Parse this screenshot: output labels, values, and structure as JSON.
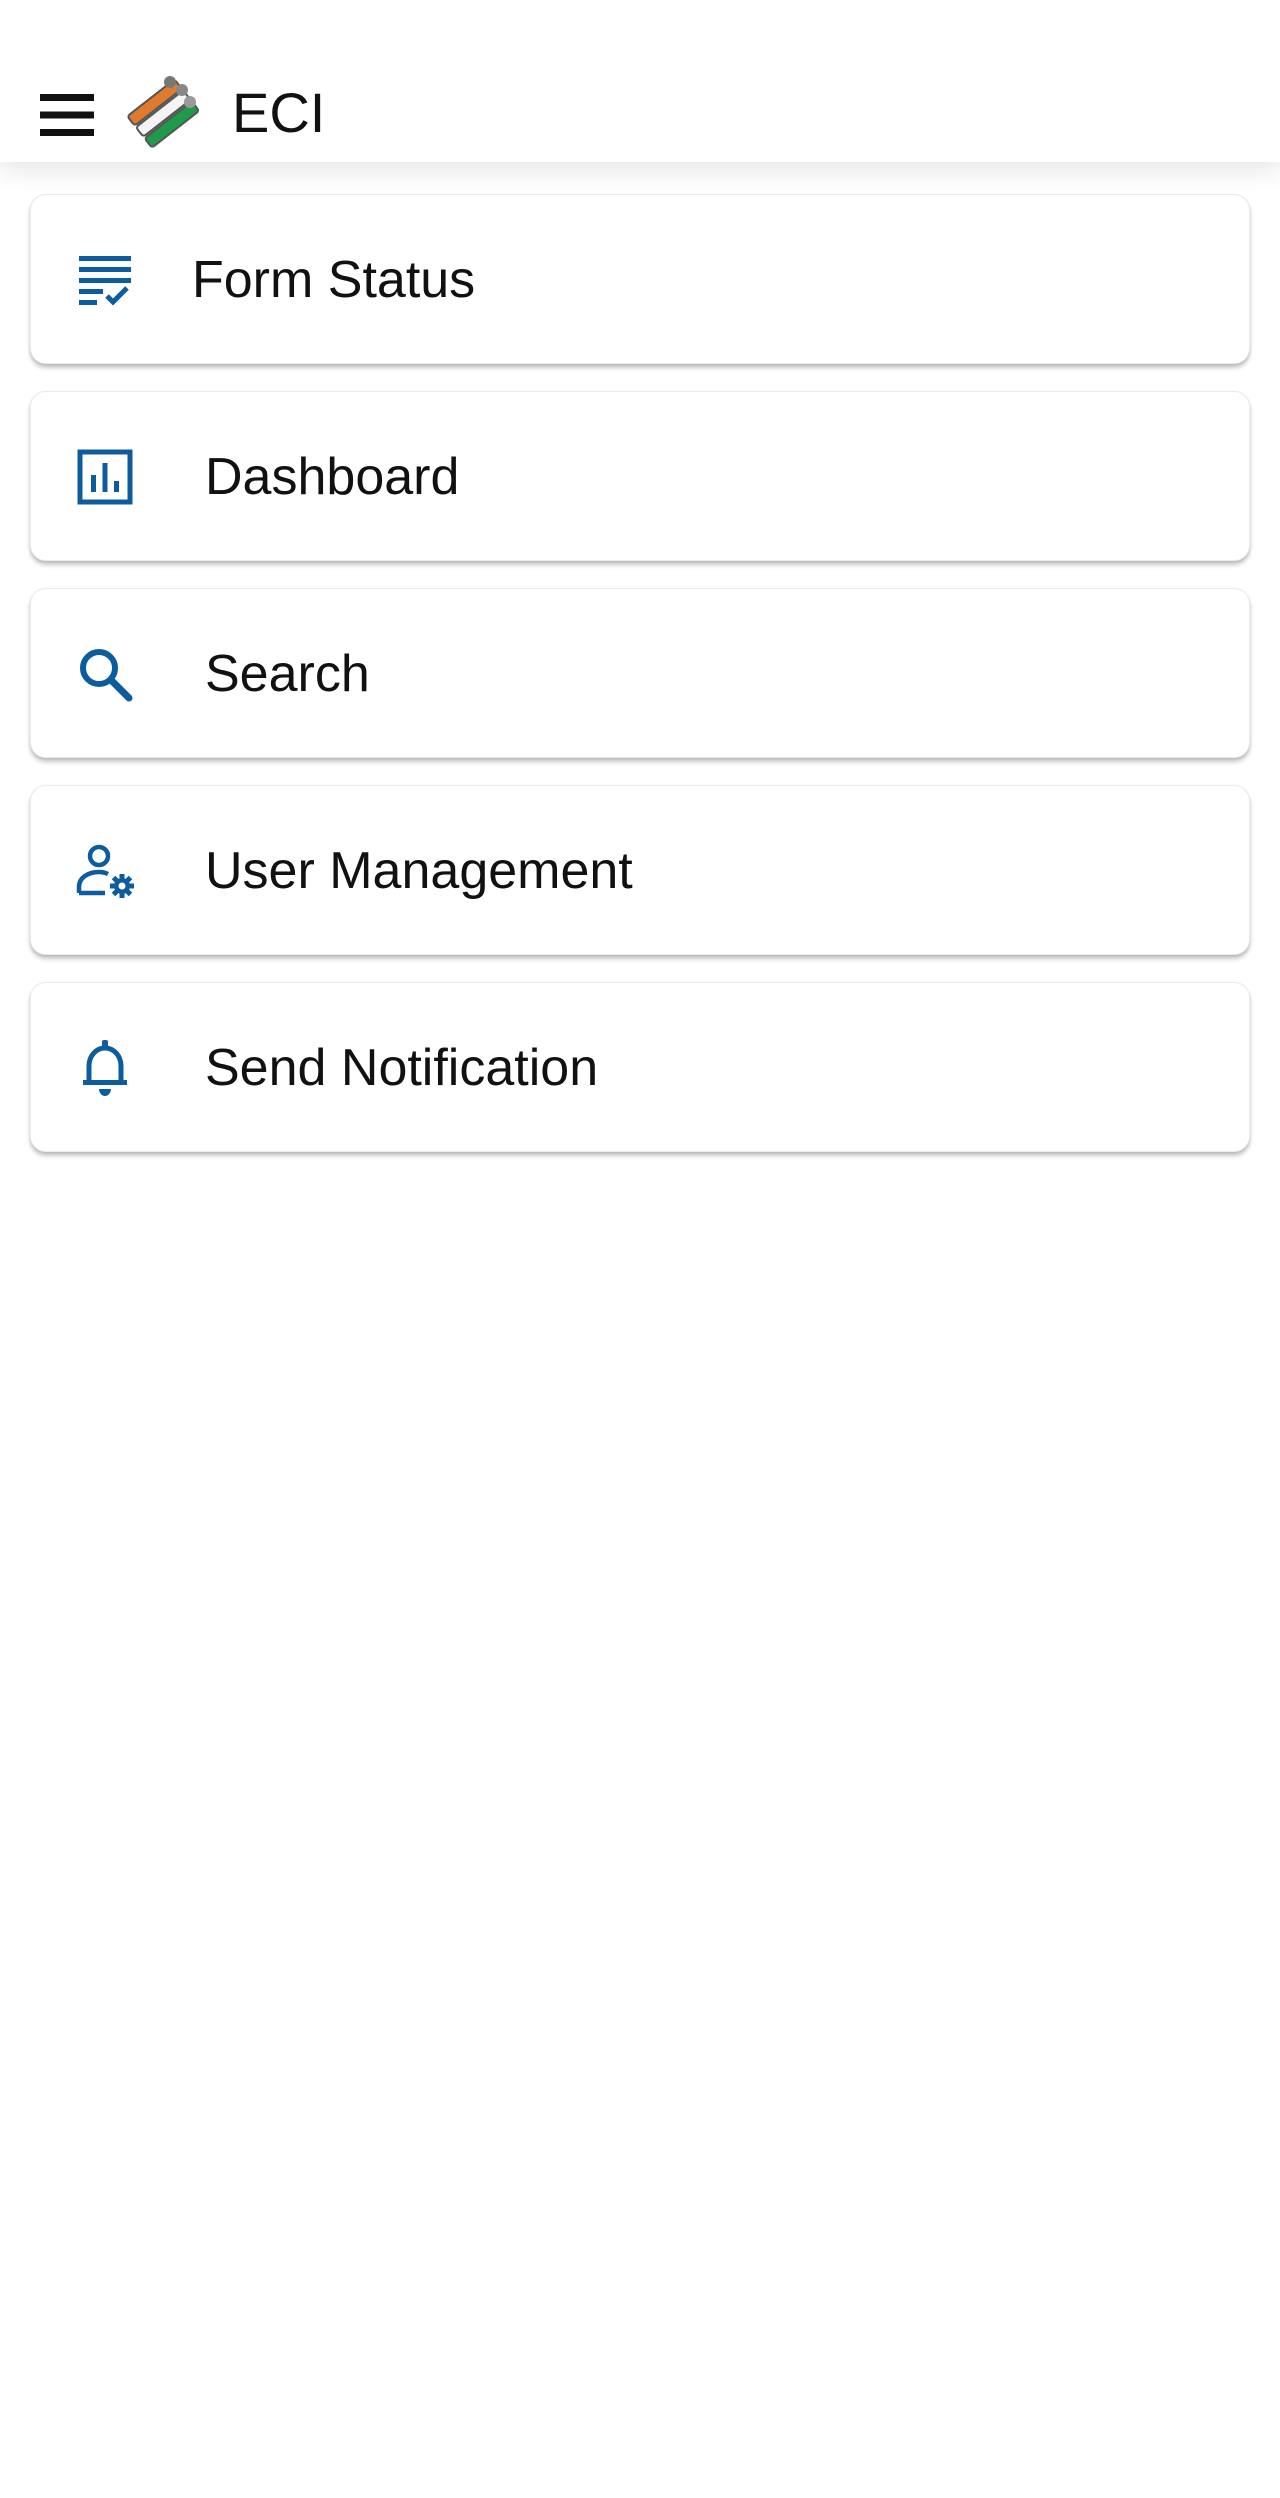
{
  "app_bar": {
    "title": "ECI",
    "menu_icon": "hamburger-icon",
    "logo_icon": "eci-ballot-logo"
  },
  "menu": {
    "items": [
      {
        "label": "Form Status",
        "icon": "checklist-icon"
      },
      {
        "label": "Dashboard",
        "icon": "bar-chart-icon"
      },
      {
        "label": "Search",
        "icon": "search-icon"
      },
      {
        "label": "User Management",
        "icon": "user-settings-icon"
      },
      {
        "label": "Send Notification",
        "icon": "bell-icon"
      }
    ]
  },
  "colors": {
    "accent": "#0d5c9e",
    "text": "#111111",
    "background": "#ffffff"
  }
}
